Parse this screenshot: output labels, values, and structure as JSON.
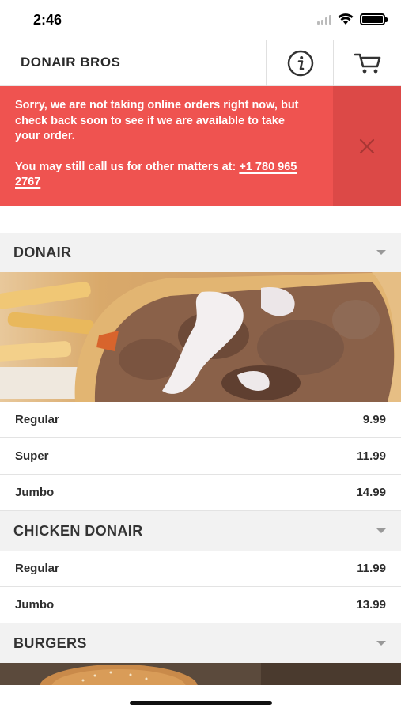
{
  "status_bar": {
    "time": "2:46",
    "signal_icon": "cellular-signal-icon",
    "wifi_icon": "wifi-icon",
    "battery_icon": "battery-icon"
  },
  "header": {
    "title": "DONAIR BROS",
    "info_icon": "info-icon",
    "cart_icon": "cart-icon"
  },
  "alert": {
    "message": "Sorry, we are not taking online orders right now, but check back soon to see if we are available to take your order.",
    "call_prefix": "You may still call us for other matters at:",
    "phone": "+1 780 965 2767",
    "close_icon": "close-icon",
    "background_color": "#ef5350"
  },
  "menu": {
    "categories": [
      {
        "title": "DONAIR",
        "image": "donair-photo",
        "items": [
          {
            "name": "Regular",
            "price": "9.99"
          },
          {
            "name": "Super",
            "price": "11.99"
          },
          {
            "name": "Jumbo",
            "price": "14.99"
          }
        ]
      },
      {
        "title": "CHICKEN DONAIR",
        "items": [
          {
            "name": "Regular",
            "price": "11.99"
          },
          {
            "name": "Jumbo",
            "price": "13.99"
          }
        ]
      },
      {
        "title": "BURGERS",
        "image": "burger-photo",
        "items": []
      }
    ]
  }
}
